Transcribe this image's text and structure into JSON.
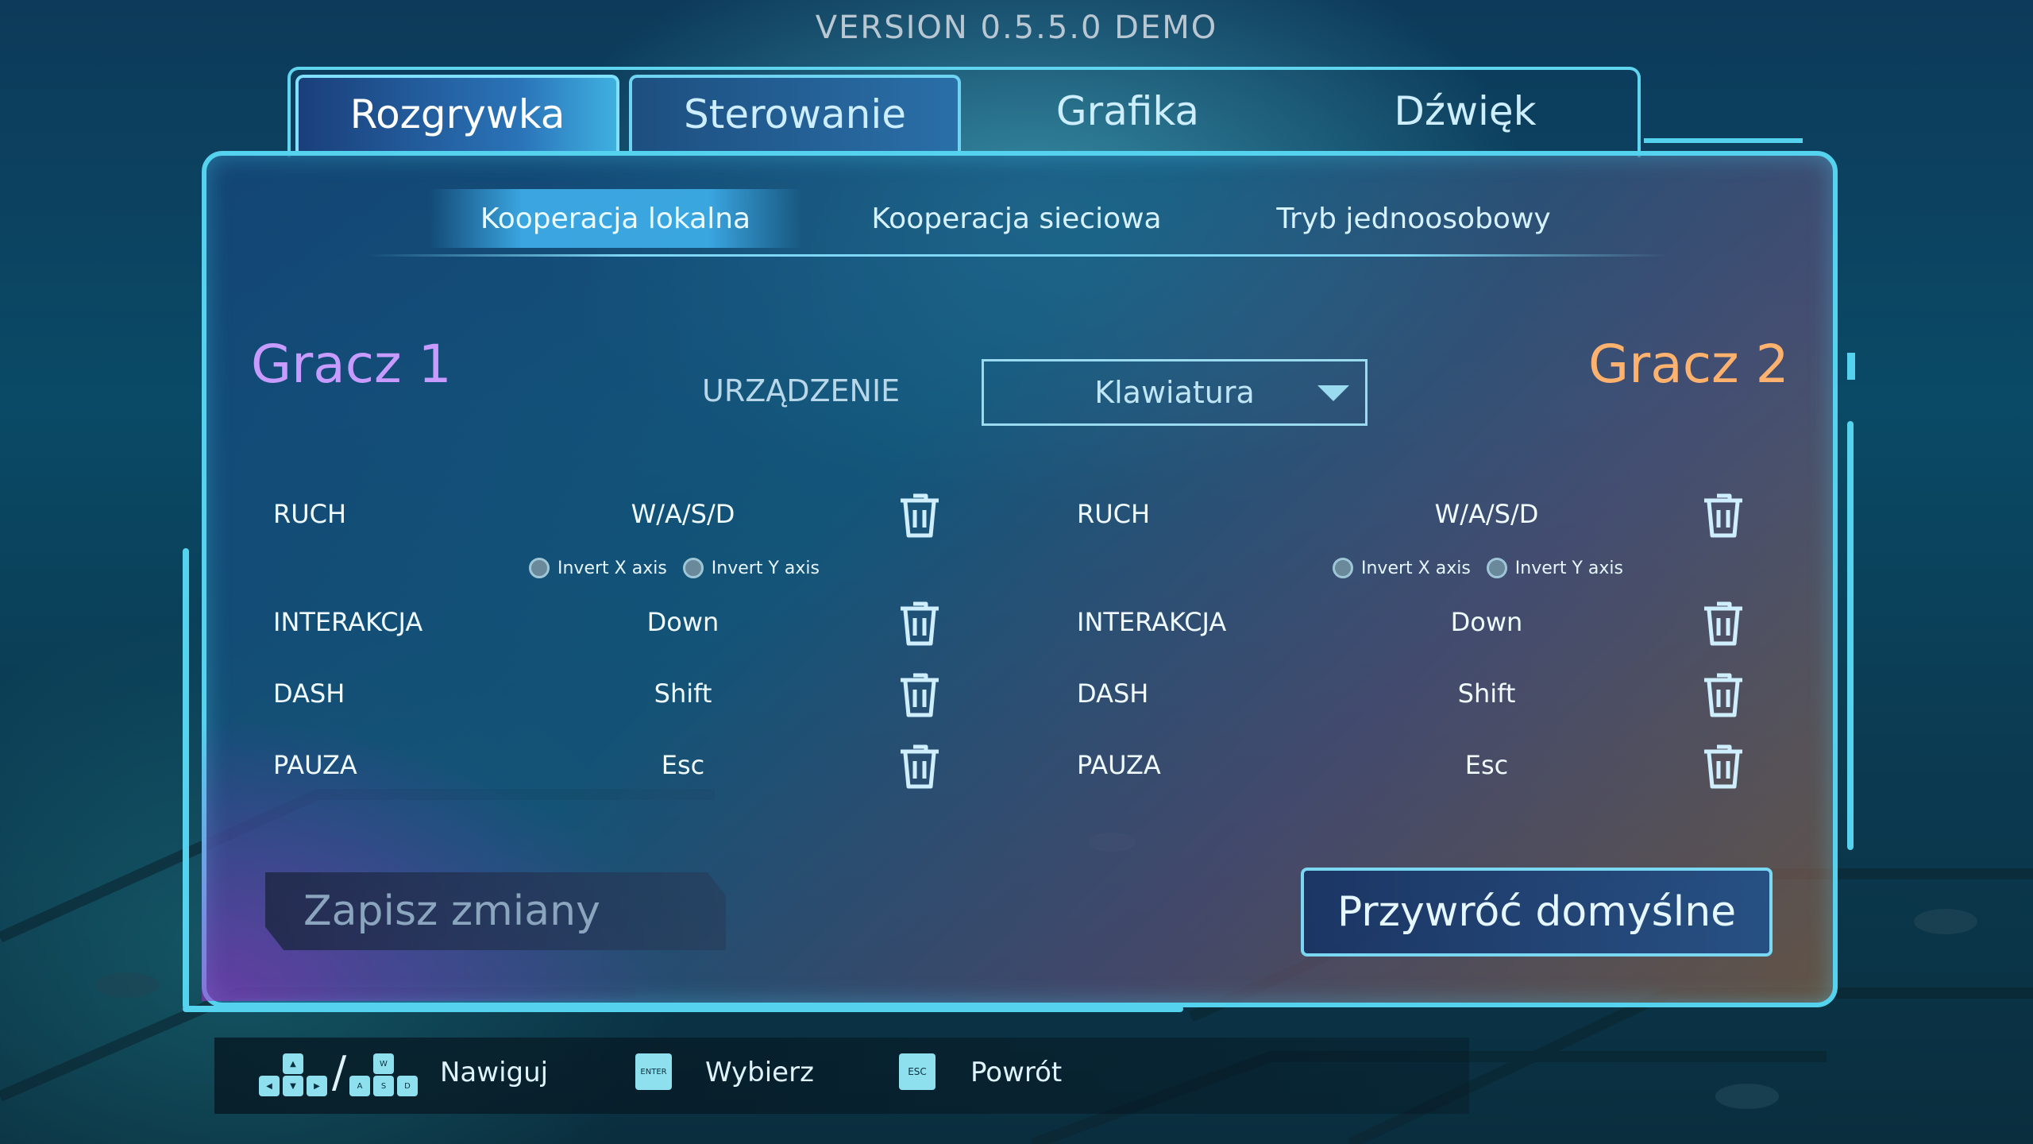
{
  "version": "VERSION 0.5.5.0 DEMO",
  "tabs": [
    {
      "label": "Rozgrywka"
    },
    {
      "label": "Sterowanie"
    },
    {
      "label": "Grafika"
    },
    {
      "label": "Dźwięk"
    }
  ],
  "subtabs": [
    {
      "label": "Kooperacja lokalna"
    },
    {
      "label": "Kooperacja sieciowa"
    },
    {
      "label": "Tryb jednoosobowy"
    }
  ],
  "players": {
    "p1": "Gracz 1",
    "p2": "Gracz 2"
  },
  "device": {
    "label": "URZĄDZENIE",
    "selected": "Klawiatura"
  },
  "bindings_p1": [
    {
      "action": "RUCH",
      "key": "W/A/S/D"
    },
    {
      "action": "INTERAKCJA",
      "key": "Down"
    },
    {
      "action": "DASH",
      "key": "Shift"
    },
    {
      "action": "PAUZA",
      "key": "Esc"
    }
  ],
  "bindings_p2": [
    {
      "action": "RUCH",
      "key": "W/A/S/D"
    },
    {
      "action": "INTERAKCJA",
      "key": "Down"
    },
    {
      "action": "DASH",
      "key": "Shift"
    },
    {
      "action": "PAUZA",
      "key": "Esc"
    }
  ],
  "invert": {
    "x": "Invert X axis",
    "y": "Invert Y axis"
  },
  "buttons": {
    "save": "Zapisz zmiany",
    "reset": "Przywróć domyślne"
  },
  "footer": {
    "navigate": "Nawiguj",
    "select": "Wybierz",
    "back": "Powrót",
    "enter_key": "ENTER",
    "esc_key": "ESC",
    "w_key": "W",
    "a_key": "A",
    "s_key": "S",
    "d_key": "D"
  },
  "colors": {
    "accent": "#55d2ee",
    "player1": "#c79bff",
    "player2": "#ffb26e"
  }
}
